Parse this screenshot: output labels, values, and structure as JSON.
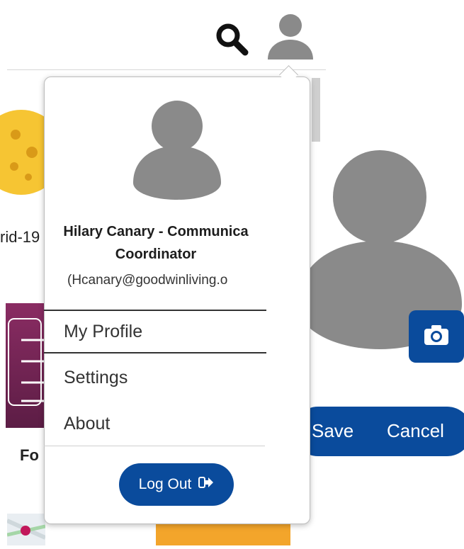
{
  "header": {
    "search_icon": "search-icon",
    "user_icon": "user-avatar-icon"
  },
  "background": {
    "tile_text_left": "rid-19",
    "tile_text_fo": "Fo"
  },
  "dropdown": {
    "name_line1": "Hilary Canary - Communica",
    "name_line2": "Coordinator",
    "email": "(Hcanary@goodwinliving.o",
    "menu": [
      {
        "label": "My Profile"
      },
      {
        "label": "Settings"
      },
      {
        "label": "About"
      }
    ],
    "logout_label": "Log Out"
  },
  "profile_panel": {
    "save_label": "Save",
    "cancel_label": "Cancel",
    "camera_icon": "camera-icon"
  },
  "colors": {
    "primary_blue": "#0a4b9c",
    "avatar_gray": "#8a8a8a",
    "purple_tile": "#7a2757",
    "yellow_tile": "#f6c533",
    "orange_tile": "#f3a52b"
  }
}
